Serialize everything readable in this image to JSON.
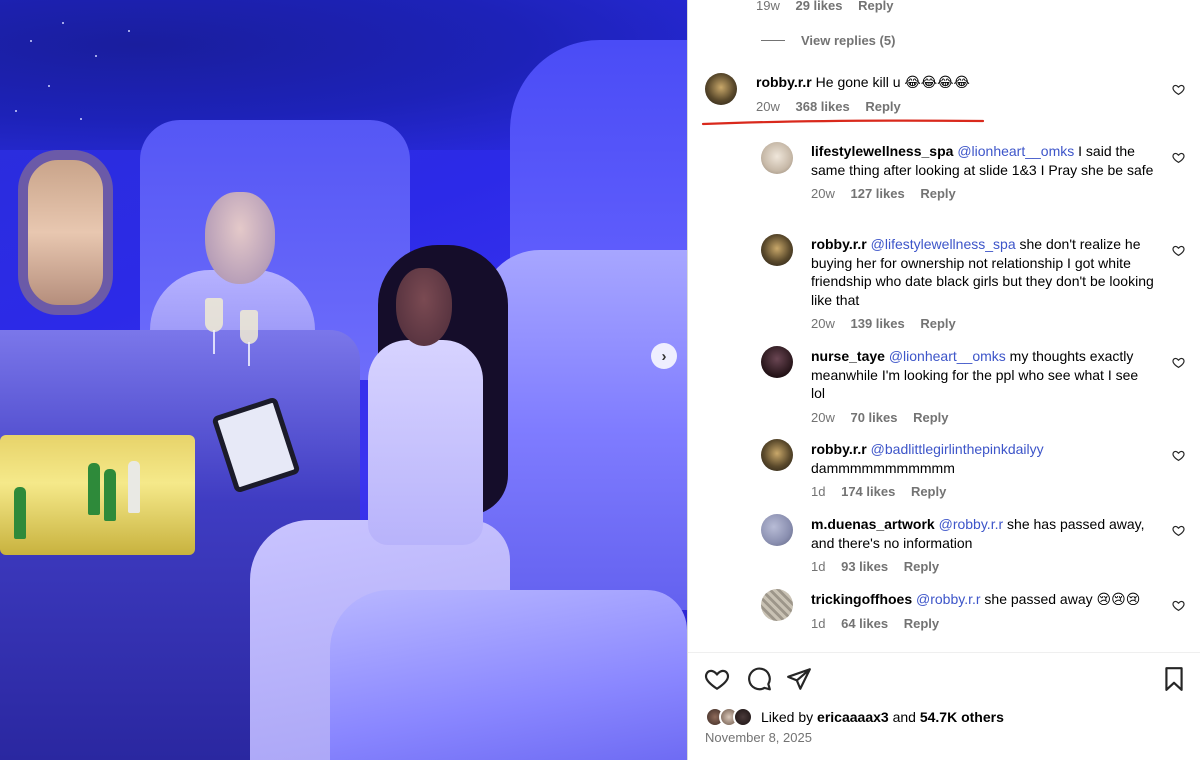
{
  "photo": {
    "next_label": "›"
  },
  "top_meta": {
    "time": "19w",
    "likes": "29 likes",
    "reply": "Reply"
  },
  "view_replies": "View replies (5)",
  "main_comment": {
    "user": "robby.r.r",
    "text": "He gone kill u 😂😂😂😂",
    "time": "20w",
    "likes": "368 likes",
    "reply": "Reply"
  },
  "replies": [
    {
      "user": "lifestylewellness_spa",
      "mention": "@lionheart__omks",
      "text": " I said the same thing after looking at slide 1&3 I Pray she be safe",
      "time": "20w",
      "likes": "127 likes",
      "reply": "Reply"
    },
    {
      "user": "robby.r.r",
      "mention": "@lifestylewellness_spa",
      "text": " she don't realize he buying her for ownership not relationship I got white friendship who date black girls but they don't be looking like that",
      "time": "20w",
      "likes": "139 likes",
      "reply": "Reply"
    },
    {
      "user": "nurse_taye",
      "mention": "@lionheart__omks",
      "text": " my thoughts exactly meanwhile I'm looking for the ppl who see what I see lol",
      "time": "20w",
      "likes": "70 likes",
      "reply": "Reply"
    },
    {
      "user": "robby.r.r",
      "mention": "@badlittlegirlinthepinkdailyy",
      "text": " dammmmmmmmmmm",
      "time": "1d",
      "likes": "174 likes",
      "reply": "Reply"
    },
    {
      "user": "m.duenas_artwork",
      "mention": "@robby.r.r",
      "text": " she has passed away, and there's no information",
      "time": "1d",
      "likes": "93 likes",
      "reply": "Reply"
    },
    {
      "user": "trickingoffhoes",
      "mention": "@robby.r.r",
      "text": " she passed away 😢😢😢",
      "time": "1d",
      "likes": "64 likes",
      "reply": "Reply"
    }
  ],
  "liked_by": {
    "prefix": "Liked by ",
    "user": "ericaaaax3",
    "mid": " and ",
    "others": "54.7K others"
  },
  "date": "November 8, 2025",
  "colors": {
    "mention": "#3d55c9",
    "meta": "#737373",
    "underline": "#d9291c"
  }
}
